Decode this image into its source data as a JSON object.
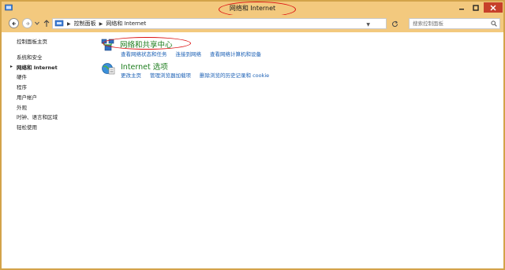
{
  "window": {
    "title": "网络和 Internet"
  },
  "nav": {
    "breadcrumb": [
      "控制面板",
      "网络和 Internet"
    ],
    "search_placeholder": "搜索控制面板"
  },
  "sidebar": {
    "items": [
      {
        "label": "控制面板主页"
      },
      {
        "label": "系统和安全"
      },
      {
        "label": "网络和 Internet",
        "current": true
      },
      {
        "label": "硬件"
      },
      {
        "label": "程序"
      },
      {
        "label": "用户帐户"
      },
      {
        "label": "外观"
      },
      {
        "label": "时钟、语言和区域"
      },
      {
        "label": "轻松使用"
      }
    ]
  },
  "categories": [
    {
      "title": "网络和共享中心",
      "icon": "network-sharing-icon",
      "links": [
        "查看网络状态和任务",
        "连接到网络",
        "查看网络计算机和设备"
      ]
    },
    {
      "title": "Internet 选项",
      "icon": "internet-options-icon",
      "links": [
        "更改主页",
        "管理浏览器加载项",
        "删除浏览的历史记录和 cookie"
      ]
    }
  ],
  "colors": {
    "titlebar": "#f3c97e",
    "accent_green": "#1e7d1e",
    "link_blue": "#1a5fb4",
    "close_red": "#c7402a",
    "annotation_red": "#dd1111"
  }
}
